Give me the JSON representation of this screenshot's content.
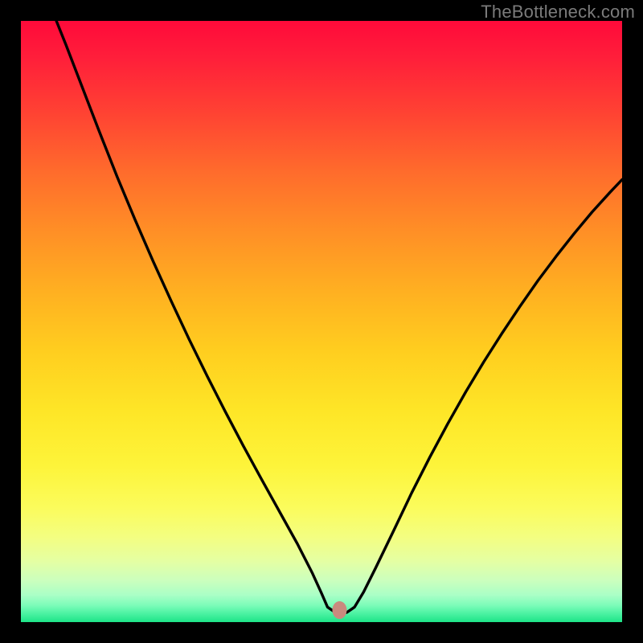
{
  "watermark": "TheBottleneck.com",
  "chart_data": {
    "type": "line",
    "title": "",
    "xlabel": "",
    "ylabel": "",
    "xlim": [
      0,
      100
    ],
    "ylim": [
      0,
      100
    ],
    "background": "rainbow-gradient",
    "marker": {
      "x": 53,
      "y": 2,
      "color": "#c98a7e"
    },
    "series": [
      {
        "name": "curve",
        "color": "#000000",
        "points": [
          {
            "x": 5.9,
            "y": 100.0
          },
          {
            "x": 7.5,
            "y": 96.0
          },
          {
            "x": 10.0,
            "y": 89.5
          },
          {
            "x": 13.0,
            "y": 81.7
          },
          {
            "x": 16.0,
            "y": 74.1
          },
          {
            "x": 19.0,
            "y": 66.9
          },
          {
            "x": 22.0,
            "y": 60.0
          },
          {
            "x": 25.0,
            "y": 53.4
          },
          {
            "x": 28.0,
            "y": 47.0
          },
          {
            "x": 31.0,
            "y": 40.9
          },
          {
            "x": 34.0,
            "y": 35.0
          },
          {
            "x": 37.0,
            "y": 29.3
          },
          {
            "x": 40.0,
            "y": 23.8
          },
          {
            "x": 43.0,
            "y": 18.4
          },
          {
            "x": 46.0,
            "y": 13.0
          },
          {
            "x": 48.5,
            "y": 8.1
          },
          {
            "x": 50.0,
            "y": 4.8
          },
          {
            "x": 51.0,
            "y": 2.5
          },
          {
            "x": 52.0,
            "y": 1.8
          },
          {
            "x": 53.0,
            "y": 1.6
          },
          {
            "x": 54.2,
            "y": 1.6
          },
          {
            "x": 55.5,
            "y": 2.5
          },
          {
            "x": 57.0,
            "y": 5.0
          },
          {
            "x": 59.0,
            "y": 9.0
          },
          {
            "x": 62.0,
            "y": 15.2
          },
          {
            "x": 65.0,
            "y": 21.5
          },
          {
            "x": 68.0,
            "y": 27.4
          },
          {
            "x": 71.0,
            "y": 33.0
          },
          {
            "x": 74.0,
            "y": 38.3
          },
          {
            "x": 77.0,
            "y": 43.3
          },
          {
            "x": 80.0,
            "y": 48.0
          },
          {
            "x": 83.0,
            "y": 52.5
          },
          {
            "x": 86.0,
            "y": 56.8
          },
          {
            "x": 89.0,
            "y": 60.8
          },
          {
            "x": 92.0,
            "y": 64.6
          },
          {
            "x": 95.0,
            "y": 68.2
          },
          {
            "x": 98.0,
            "y": 71.5
          },
          {
            "x": 100.0,
            "y": 73.6
          }
        ]
      }
    ]
  }
}
